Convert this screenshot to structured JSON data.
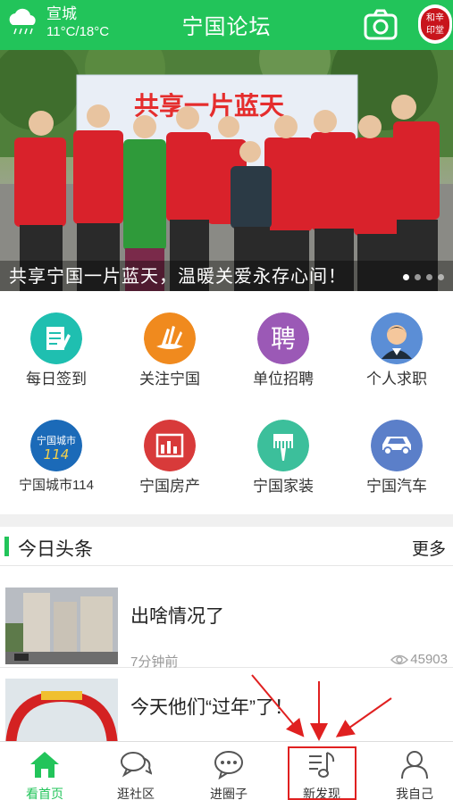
{
  "header": {
    "weather_city": "宣城",
    "weather_temp": "11°C/18°C",
    "title": "宁国论坛",
    "camera_icon": "camera-icon",
    "seal_text": [
      "辛",
      "和",
      "印",
      "堂"
    ]
  },
  "banner": {
    "caption": "共享宁国一片蓝天，温暖关爱永存心间！",
    "sign_text": "共享一片蓝天",
    "slide_count": 4,
    "active_slide": 1
  },
  "grid": {
    "items": [
      {
        "label": "每日签到",
        "icon": "checkin-icon",
        "color": "#1fbfb0"
      },
      {
        "label": "关注宁国",
        "icon": "follow-icon",
        "color": "#f08a1e"
      },
      {
        "label": "单位招聘",
        "icon": "recruit-icon",
        "color": "#9b59b6",
        "glyph": "聘"
      },
      {
        "label": "个人求职",
        "icon": "job-seeker-icon",
        "color": "#5b8ed6"
      },
      {
        "label": "宁国城市114",
        "icon": "city114-icon",
        "color": "#1b6ab8",
        "glyph": "宁国城市",
        "glyph2": "114"
      },
      {
        "label": "宁国房产",
        "icon": "property-icon",
        "color": "#d83a3a"
      },
      {
        "label": "宁国家装",
        "icon": "decoration-icon",
        "color": "#3cbf9b"
      },
      {
        "label": "宁国汽车",
        "icon": "car-icon",
        "color": "#5b7fc9"
      }
    ]
  },
  "headlines": {
    "title": "今日头条",
    "more": "更多",
    "items": [
      {
        "title": "出啥情况了",
        "time": "7分钟前",
        "views": "45903"
      },
      {
        "title": "今天他们“过年”了！",
        "time": "",
        "views": ""
      }
    ]
  },
  "tabbar": {
    "tabs": [
      {
        "label": "看首页",
        "icon": "home-icon",
        "active": true
      },
      {
        "label": "逛社区",
        "icon": "community-icon",
        "active": false
      },
      {
        "label": "进圈子",
        "icon": "circle-chat-icon",
        "active": false
      },
      {
        "label": "新发现",
        "icon": "discover-music-icon",
        "active": false
      },
      {
        "label": "我自己",
        "icon": "profile-icon",
        "active": false
      }
    ]
  },
  "colors": {
    "brand": "#22c45a",
    "highlight": "#e02020"
  }
}
